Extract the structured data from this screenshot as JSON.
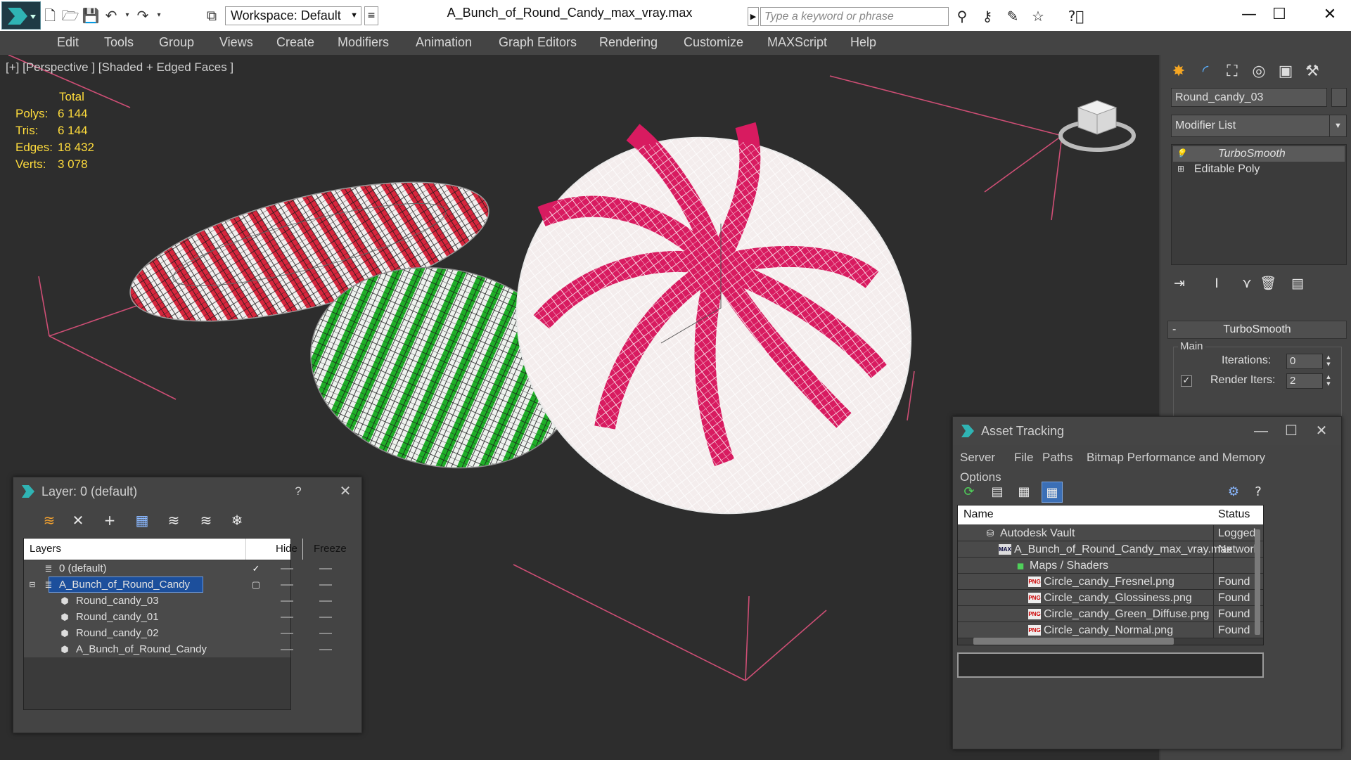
{
  "title_bar": {
    "workspace": "Workspace: Default",
    "document_title": "A_Bunch_of_Round_Candy_max_vray.max",
    "search_placeholder": "Type a keyword or phrase"
  },
  "menu": [
    "Edit",
    "Tools",
    "Group",
    "Views",
    "Create",
    "Modifiers",
    "Animation",
    "Graph Editors",
    "Rendering",
    "Customize",
    "MAXScript",
    "Help"
  ],
  "viewport": {
    "label": "[+] [Perspective ] [Shaded + Edged Faces ]",
    "stats_header": "Total",
    "stats": [
      {
        "key": "Polys:",
        "value": "6 144"
      },
      {
        "key": "Tris:",
        "value": "6 144"
      },
      {
        "key": "Edges:",
        "value": "18 432"
      },
      {
        "key": "Verts:",
        "value": "3 078"
      }
    ]
  },
  "command_panel": {
    "object_name": "Round_candy_03",
    "modifier_list": "Modifier List",
    "stack": [
      "TurboSmooth",
      "Editable Poly"
    ],
    "rollout_title": "TurboSmooth",
    "group_main": "Main",
    "iterations_label": "Iterations:",
    "iterations_value": "0",
    "render_iters_label": "Render Iters:",
    "render_iters_value": "2",
    "render_iters_checked": true
  },
  "layer_window": {
    "title": "Layer: 0 (default)",
    "help": "?",
    "columns": {
      "layers": "Layers",
      "hide": "Hide",
      "freeze": "Freeze"
    },
    "rows": [
      {
        "name": "0 (default)"
      },
      {
        "name": "A_Bunch_of_Round_Candy"
      },
      {
        "name": "Round_candy_03"
      },
      {
        "name": "Round_candy_01"
      },
      {
        "name": "Round_candy_02"
      },
      {
        "name": "A_Bunch_of_Round_Candy"
      }
    ]
  },
  "asset_tracking": {
    "title": "Asset Tracking",
    "menu": [
      "Server",
      "File",
      "Paths",
      "Bitmap Performance and Memory",
      "Options"
    ],
    "columns": {
      "name": "Name",
      "status": "Status"
    },
    "rows": [
      {
        "name": "Autodesk Vault",
        "status": "Logged"
      },
      {
        "name": "A_Bunch_of_Round_Candy_max_vray.max",
        "status": "Network"
      },
      {
        "name": "Maps / Shaders",
        "status": ""
      },
      {
        "name": "Circle_candy_Fresnel.png",
        "status": "Found"
      },
      {
        "name": "Circle_candy_Glossiness.png",
        "status": "Found"
      },
      {
        "name": "Circle_candy_Green_Diffuse.png",
        "status": "Found"
      },
      {
        "name": "Circle_candy_Normal.png",
        "status": "Found"
      }
    ],
    "file_icon_text": "PNG",
    "max_icon_text": "MAX"
  },
  "colors": {
    "viewport_bg": "#2d2d2d",
    "stats_yellow": "#ffdc3c",
    "candy_red": "#d7263d",
    "candy_pink": "#d81b60",
    "candy_green": "#1fae28",
    "selection_blue": "#1c4f9c",
    "grid_pink": "#e0527d"
  }
}
